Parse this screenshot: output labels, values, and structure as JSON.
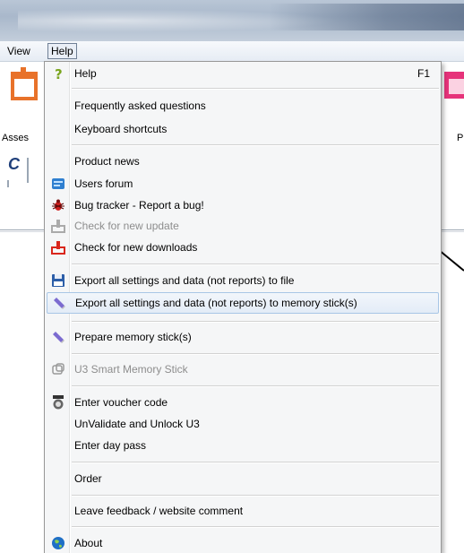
{
  "menubar": {
    "view": "View",
    "help": "Help"
  },
  "background": {
    "left_label": "Asses",
    "left_letter": "C",
    "right_label": "P"
  },
  "menu": {
    "items": [
      {
        "label": "Help",
        "shortcut": "F1",
        "icon": "question-icon",
        "disabled": false
      },
      {
        "label": "Frequently asked questions",
        "disabled": false
      },
      {
        "label": "Keyboard shortcuts",
        "disabled": false
      },
      {
        "label": "Product news",
        "disabled": false
      },
      {
        "label": "Users forum",
        "icon": "forum-icon",
        "disabled": false
      },
      {
        "label": "Bug tracker - Report a bug!",
        "icon": "bug-icon",
        "disabled": false
      },
      {
        "label": "Check for new update",
        "icon": "update-icon",
        "disabled": true
      },
      {
        "label": "Check for new downloads",
        "icon": "download-icon",
        "disabled": false
      },
      {
        "label": "Export all settings and data (not reports) to file",
        "icon": "save-icon",
        "disabled": false
      },
      {
        "label": "Export all settings and data (not reports) to memory stick(s)",
        "icon": "memory-stick-icon",
        "disabled": false,
        "highlighted": true
      },
      {
        "label": "Prepare memory stick(s)",
        "icon": "memory-stick-icon",
        "disabled": false
      },
      {
        "label": "U3 Smart Memory Stick",
        "icon": "u3-icon",
        "disabled": true
      },
      {
        "label": "Enter voucher code",
        "icon": "voucher-icon",
        "disabled": false
      },
      {
        "label": "UnValidate and Unlock U3",
        "disabled": false
      },
      {
        "label": "Enter day pass",
        "disabled": false
      },
      {
        "label": "Order",
        "disabled": false
      },
      {
        "label": "Leave feedback / website comment",
        "disabled": false
      },
      {
        "label": "About",
        "icon": "globe-icon",
        "disabled": false
      }
    ]
  },
  "colors": {
    "highlight_border": "#a8c6e6",
    "disabled_text": "#8d8d8d",
    "accent_orange": "#e8722a"
  }
}
